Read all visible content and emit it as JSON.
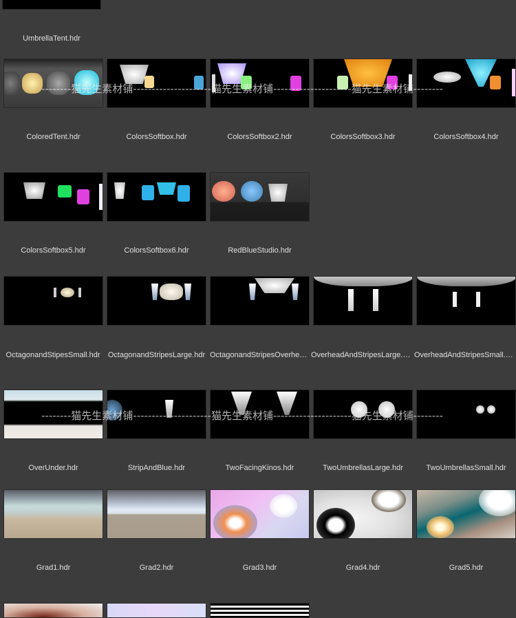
{
  "browser": {
    "items": [
      {
        "name": "UmbrellaTent.hdr"
      },
      {
        "name": "ColoredTent.hdr"
      },
      {
        "name": "ColorsSoftbox.hdr"
      },
      {
        "name": "ColorsSoftbox2.hdr"
      },
      {
        "name": "ColorsSoftbox3.hdr"
      },
      {
        "name": "ColorsSoftbox4.hdr"
      },
      {
        "name": "ColorsSoftbox5.hdr"
      },
      {
        "name": "ColorsSoftbox6.hdr"
      },
      {
        "name": "RedBlueStudio.hdr"
      },
      {
        "name": "OctagonandStipesSmall.hdr"
      },
      {
        "name": "OctagonandStripesLarge.hdr"
      },
      {
        "name": "OctagonandStripesOverhead.hdr"
      },
      {
        "name": "OverheadAndStripesLarge.hdr"
      },
      {
        "name": "OverheadAndStripesSmall.hdr"
      },
      {
        "name": "OverUnder.hdr"
      },
      {
        "name": "StripAndBlue.hdr"
      },
      {
        "name": "TwoFacingKinos.hdr"
      },
      {
        "name": "TwoUmbrellasLarge.hdr"
      },
      {
        "name": "TwoUmbrellasSmall.hdr"
      },
      {
        "name": "Grad1.hdr"
      },
      {
        "name": "Grad2.hdr"
      },
      {
        "name": "Grad3.hdr"
      },
      {
        "name": "Grad4.hdr"
      },
      {
        "name": "Grad5.hdr"
      }
    ]
  },
  "watermark": {
    "line1": "--------猫先生素材铺---------------------猫先生素材铺---------------------猫先生素材铺--------",
    "line2": "--------猫先生素材铺---------------------猫先生素材铺---------------------猫先生素材铺--------"
  }
}
